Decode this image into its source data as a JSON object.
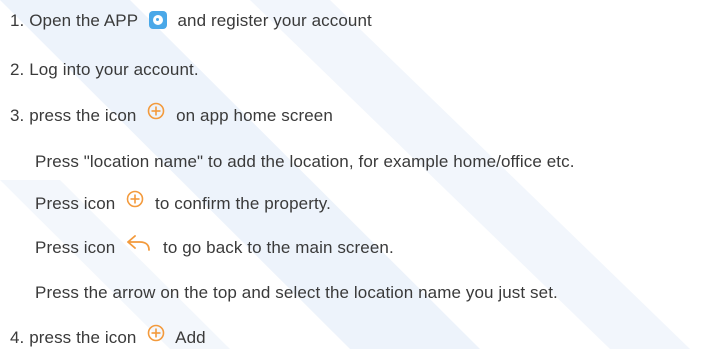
{
  "colors": {
    "text": "#3a3a3a",
    "accent_orange": "#f39a3c",
    "app_icon_blue": "#4aa8e8",
    "background_stripe": "#eaf1fa"
  },
  "steps": {
    "step1": {
      "before": "1. Open the APP",
      "after": "and register your account",
      "icon": "app-icon"
    },
    "step2": {
      "text": "2. Log into your account."
    },
    "step3": {
      "before": "3. press the icon",
      "after": "on app home screen",
      "icon": "plus-circle-icon"
    },
    "step3_sub1": {
      "text": "Press \"location name\" to add the location, for example home/office etc."
    },
    "step3_sub2": {
      "before": "Press icon",
      "after": "to confirm the property.",
      "icon": "plus-circle-icon"
    },
    "step3_sub3": {
      "before": "Press icon",
      "after": "to go back to the main screen.",
      "icon": "back-arrow-icon"
    },
    "step3_sub4": {
      "text": "Press the arrow on the top and select the location name you just set."
    },
    "step4": {
      "before": "4. press the icon",
      "after": "Add",
      "icon": "plus-circle-icon"
    }
  }
}
